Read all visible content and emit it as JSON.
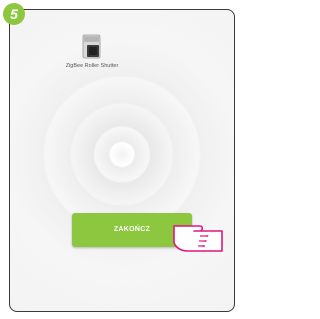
{
  "step": {
    "number": "5"
  },
  "device": {
    "label": "ZigBee Roller Shutter",
    "icon": "roller-shutter-icon"
  },
  "action": {
    "finish_label": "ZAKOŃCZ"
  },
  "colors": {
    "accent": "#8dc63f",
    "frame": "#3a3a3a"
  },
  "pointer": {
    "icon": "hand-pointer-icon"
  }
}
